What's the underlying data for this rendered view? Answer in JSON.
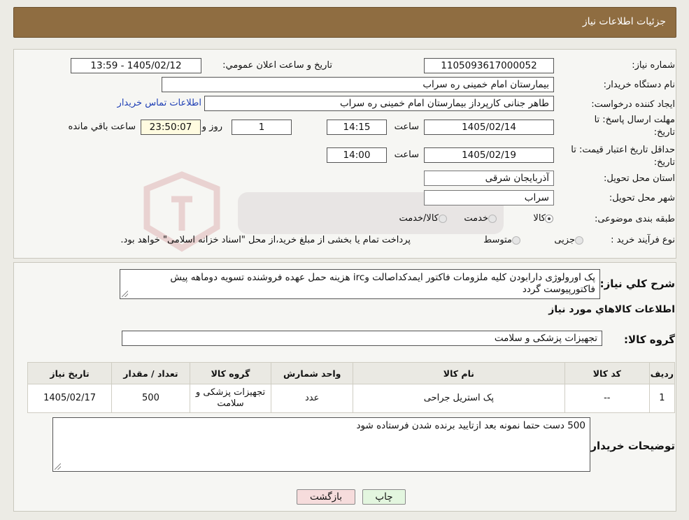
{
  "header": {
    "title": "جزئیات اطلاعات نیاز"
  },
  "form": {
    "need_number_label": "شماره نیاز:",
    "need_number": "1105093617000052",
    "announce_label": "تاریخ و ساعت اعلان عمومي:",
    "announce_value": "1405/02/12 - 13:59",
    "buyer_org_label": "نام دستگاه خریدار:",
    "buyer_org": "بیمارستان امام خمینی ره  سراب",
    "requester_label": "ایجاد کننده درخواست:",
    "requester": "طاهر جنانی کارپرداز بیمارستان امام خمینی ره  سراب",
    "contact_link": "اطلاعات تماس خریدار",
    "deadline_label_1": "مهلت ارسال پاسخ: تا",
    "deadline_label_2": "تاریخ:",
    "deadline_date": "1405/02/14",
    "time_label": "ساعت",
    "deadline_time": "14:15",
    "days_value": "1",
    "days_label": "روز و",
    "remaining_time": "23:50:07",
    "remaining_label": "ساعت باقي مانده",
    "validity_label_1": "حداقل تاریخ اعتبار قیمت: تا",
    "validity_label_2": "تاریخ:",
    "validity_date": "1405/02/19",
    "validity_time_label": "ساعت",
    "validity_time": "14:00",
    "province_label": "استان محل تحویل:",
    "province": "آذربایجان شرقی",
    "city_label": "شهر محل تحویل:",
    "city": "سراب",
    "category_label": "طبقه بندی موضوعی:",
    "category_options": [
      "کالا",
      "خدمت",
      "کالا/خدمت"
    ],
    "category_selected": "کالا",
    "process_label": "نوع فرآیند خرید :",
    "process_options": [
      "جزیی",
      "متوسط"
    ],
    "process_note": "پرداخت تمام یا بخشی از مبلغ خرید،از محل \"اسناد خزانه اسلامی\" خواهد بود."
  },
  "summary": {
    "label": "شرح کلي نياز:",
    "text": "پک اورولوژی دارابودن کلیه ملزومات فاکتور ایمدکداصالت وirc هزینه حمل عهده فروشنده تسویه دوماهه پیش فاکتورپیوست گردد"
  },
  "items_section": {
    "title": "اطلاعات کالاهاي مورد نياز",
    "group_label": "گروه کالا:",
    "group_value": "تجهیزات پزشکی و سلامت",
    "columns": [
      "رديف",
      "کد کالا",
      "نام کالا",
      "واحد شمارش",
      "گروه کالا",
      "تعداد / مقدار",
      "تاریخ نیاز"
    ],
    "rows": [
      [
        "1",
        "--",
        "پک استریل جراحی",
        "عدد",
        "تجهیزات پزشکی و سلامت",
        "500",
        "1405/02/17"
      ]
    ]
  },
  "buyer_notes": {
    "label": "توضیحات خریدار:",
    "text": "500 دست حتما نمونه بعد ازتایید برنده شدن فرستاده شود"
  },
  "buttons": {
    "print": "چاپ",
    "back": "بازگشت"
  },
  "colors": {
    "header_bg": "#8f6d41",
    "page_bg": "#ecebe5",
    "panel_bg": "#f6f6f3",
    "yellow_field": "#fffbe0",
    "back_button": "#f6dcdc",
    "print_button": "#e3f6df",
    "link": "#1f3fb5"
  }
}
